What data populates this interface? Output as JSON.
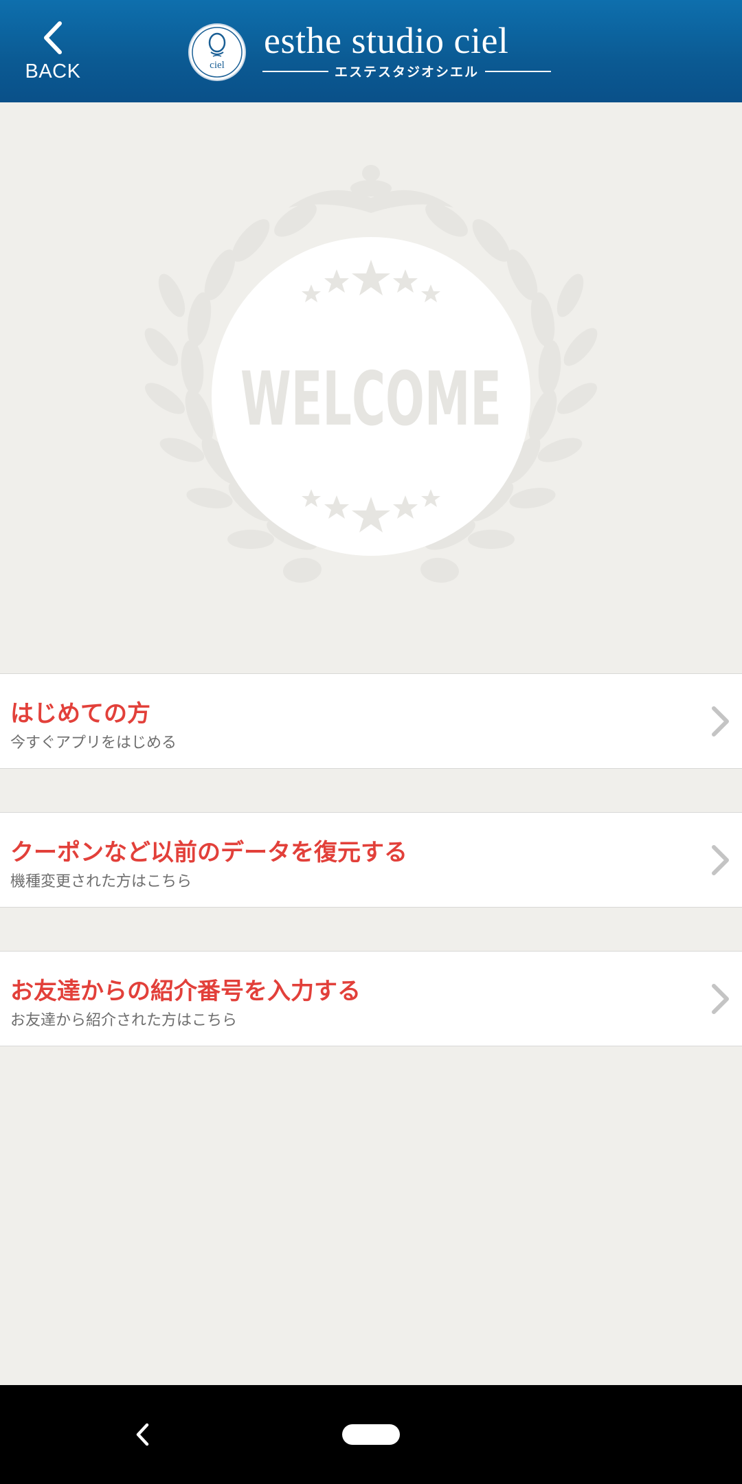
{
  "header": {
    "back_label": "BACK",
    "logo_circle_text": "ciel",
    "brand_name": "esthe studio ciel",
    "brand_kana": "エステスタジオシエル",
    "background_color": "#0b5a93"
  },
  "hero": {
    "emblem_text": "WELCOME"
  },
  "menu": {
    "items": [
      {
        "title": "はじめての方",
        "subtitle": "今すぐアプリをはじめる"
      },
      {
        "title": "クーポンなど以前のデータを復元する",
        "subtitle": "機種変更された方はこちら"
      },
      {
        "title": "お友達からの紹介番号を入力する",
        "subtitle": "お友達から紹介された方はこちら"
      }
    ],
    "title_color": "#e2403a",
    "chevron_icon": "chevron-right-icon"
  },
  "system_nav": {
    "back_icon": "nav-back-icon",
    "home_icon": "home-pill-icon"
  }
}
